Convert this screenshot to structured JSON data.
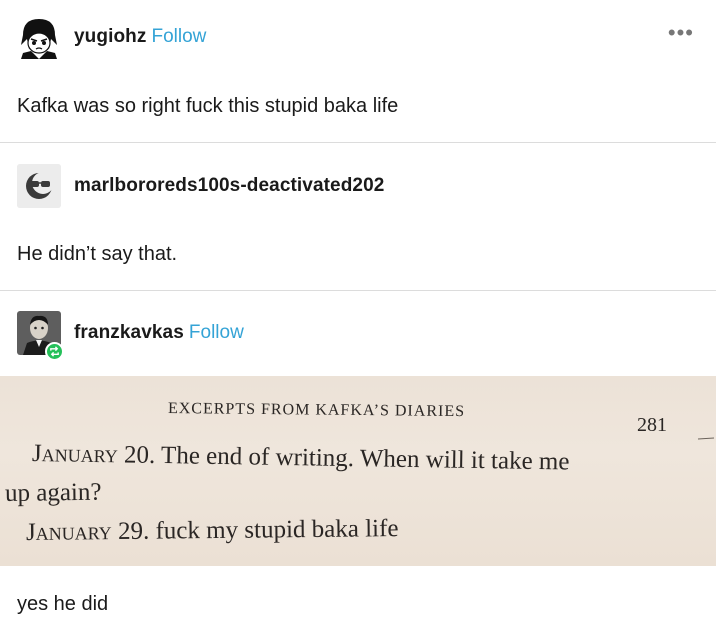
{
  "posts": [
    {
      "username": "yugiohz",
      "follow_label": "Follow",
      "text": "Kafka was so right fuck this stupid baka life"
    },
    {
      "username": "marlbororeds100s-deactivated202",
      "text": "He didn’t say that."
    },
    {
      "username": "franzkavkas",
      "follow_label": "Follow",
      "image": {
        "heading": "EXCERPTS FROM KAFKA’S DIARIES",
        "page_number": "281",
        "entry1_month": "January",
        "entry1_text": " 20. The end of writing. When will it take me",
        "entry1_cont": "up again?",
        "entry2_month": "January",
        "entry2_text": " 29. fuck my stupid baka life"
      },
      "text": "yes he did"
    }
  ],
  "more_label": "•••",
  "colors": {
    "follow": "#34a3d6",
    "reblog_badge": "#25c05a",
    "divider": "#dcdcdc"
  },
  "icons": {
    "more": "more-options-icon",
    "reblog": "reblog-icon"
  }
}
